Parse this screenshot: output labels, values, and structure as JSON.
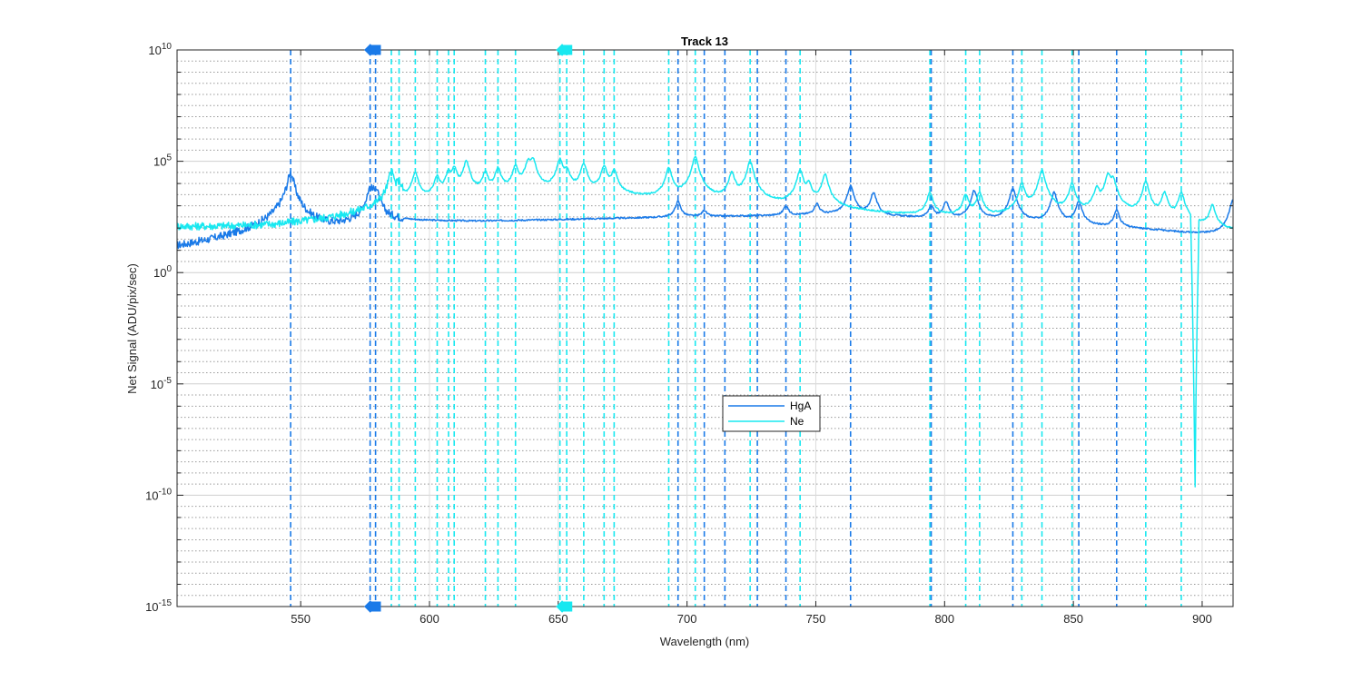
{
  "chart_data": {
    "type": "line",
    "title": "Track 13",
    "xlabel": "Wavelength (nm)",
    "ylabel": "Net Signal (ADU/pix/sec)",
    "xlim": [
      502,
      912
    ],
    "ylim_log10": [
      -15,
      10
    ],
    "yscale": "log",
    "grid": "on",
    "x_ticks": [
      550,
      600,
      650,
      700,
      750,
      800,
      850,
      900
    ],
    "y_ticks": [
      {
        "base": "10",
        "exp": "10",
        "value": 10
      },
      {
        "base": "10",
        "exp": "5",
        "value": 5
      },
      {
        "base": "10",
        "exp": "0",
        "value": 0
      },
      {
        "base": "10",
        "exp": "-5",
        "value": -5
      },
      {
        "base": "10",
        "exp": "-10",
        "value": -10
      },
      {
        "base": "10",
        "exp": "-15",
        "value": -15
      }
    ],
    "legend": {
      "placement": "center",
      "entries": [
        {
          "name": "HgA",
          "color": "#1a7ae8"
        },
        {
          "name": "Ne",
          "color": "#18e8f0"
        }
      ]
    },
    "series": [
      {
        "name": "HgA",
        "color": "#1a7ae8",
        "baseline_log10": [
          [
            502,
            0.2
          ],
          [
            530,
            1.0
          ],
          [
            560,
            1.8
          ],
          [
            580,
            2.3
          ],
          [
            620,
            2.3
          ],
          [
            700,
            2.5
          ],
          [
            760,
            2.6
          ],
          [
            800,
            2.4
          ],
          [
            850,
            2.1
          ],
          [
            880,
            1.9
          ],
          [
            910,
            1.6
          ]
        ],
        "peaks_log10": [
          [
            546.1,
            4.5
          ],
          [
            576.96,
            3.8
          ],
          [
            579.07,
            3.8
          ],
          [
            696.5,
            3.2
          ],
          [
            706.7,
            2.8
          ],
          [
            738.4,
            3.0
          ],
          [
            750.4,
            3.1
          ],
          [
            763.5,
            3.9
          ],
          [
            772.4,
            3.6
          ],
          [
            794.8,
            3.0
          ],
          [
            800.6,
            3.2
          ],
          [
            811.5,
            3.7
          ],
          [
            826.5,
            3.8
          ],
          [
            842.5,
            3.6
          ],
          [
            852.1,
            3.2
          ],
          [
            866.8,
            2.8
          ],
          [
            912,
            3.3
          ]
        ]
      },
      {
        "name": "Ne",
        "color": "#18e8f0",
        "baseline_log10": [
          [
            502,
            1.8
          ],
          [
            540,
            1.5
          ],
          [
            560,
            1.8
          ],
          [
            580,
            2.5
          ],
          [
            620,
            3.3
          ],
          [
            660,
            3.5
          ],
          [
            700,
            3.1
          ],
          [
            740,
            2.8
          ],
          [
            780,
            2.5
          ],
          [
            820,
            2.3
          ],
          [
            860,
            2.1
          ],
          [
            900,
            1.5
          ],
          [
            912,
            1.3
          ]
        ],
        "peaks_log10": [
          [
            585.2,
            4.5
          ],
          [
            588.2,
            4.0
          ],
          [
            594.5,
            4.5
          ],
          [
            603.0,
            4.3
          ],
          [
            607.4,
            4.5
          ],
          [
            609.6,
            4.7
          ],
          [
            614.3,
            5.0
          ],
          [
            621.7,
            4.5
          ],
          [
            626.6,
            4.7
          ],
          [
            633.4,
            4.8
          ],
          [
            638.3,
            5.0
          ],
          [
            640.2,
            5.1
          ],
          [
            650.65,
            5.1
          ],
          [
            653.3,
            4.6
          ],
          [
            659.9,
            4.9
          ],
          [
            667.8,
            4.8
          ],
          [
            671.7,
            4.6
          ],
          [
            692.9,
            4.7
          ],
          [
            703.2,
            5.2
          ],
          [
            717.4,
            4.5
          ],
          [
            724.5,
            5.0
          ],
          [
            743.9,
            4.6
          ],
          [
            747.2,
            4.0
          ],
          [
            753.6,
            4.4
          ],
          [
            794.3,
            3.6
          ],
          [
            808.2,
            3.5
          ],
          [
            813.6,
            3.6
          ],
          [
            830.0,
            4.0
          ],
          [
            837.8,
            4.6
          ],
          [
            849.5,
            4.0
          ],
          [
            859.1,
            3.8
          ],
          [
            863.5,
            4.4
          ],
          [
            865.4,
            4.2
          ],
          [
            878.1,
            4.1
          ],
          [
            885.4,
            3.6
          ],
          [
            891.9,
            3.6
          ],
          [
            897.2,
            -11.3
          ],
          [
            904.0,
            3.0
          ]
        ]
      }
    ],
    "reference_lines": {
      "HgA": [
        546.1,
        576.96,
        579.07,
        696.5,
        706.7,
        714.7,
        727.3,
        738.4,
        763.5,
        794.8,
        826.5,
        852.1,
        866.8
      ],
      "Ne": [
        585.2,
        588.2,
        594.5,
        603.0,
        607.4,
        609.6,
        621.7,
        626.6,
        633.4,
        650.65,
        653.3,
        659.9,
        667.8,
        671.7,
        692.9,
        703.2,
        724.5,
        743.9,
        794.3,
        808.2,
        813.6,
        830.0,
        837.8,
        849.5,
        878.1,
        891.9
      ]
    },
    "markers": [
      {
        "series": "HgA",
        "shape": "diamond",
        "x": 577.0
      },
      {
        "series": "HgA",
        "shape": "square",
        "x": 579.2
      },
      {
        "series": "Ne",
        "shape": "diamond",
        "x": 651.5
      },
      {
        "series": "Ne",
        "shape": "square",
        "x": 653.5
      }
    ]
  }
}
